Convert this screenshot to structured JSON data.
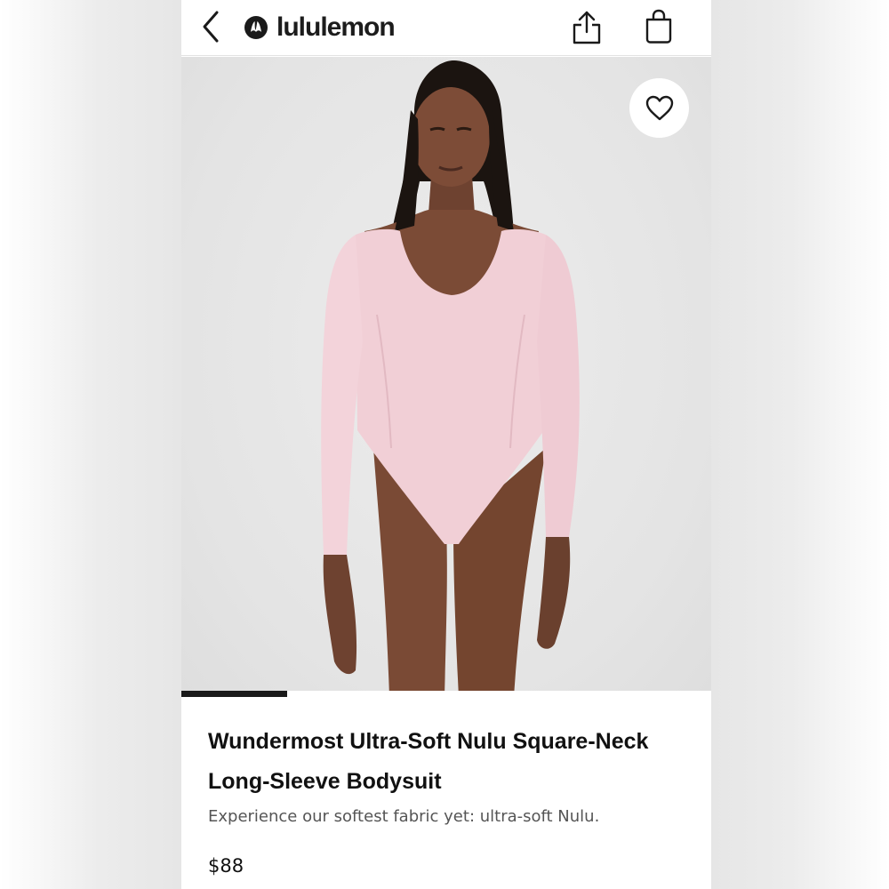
{
  "header": {
    "brand_name": "lululemon",
    "icons": {
      "back": "chevron-left-icon",
      "logo": "lululemon-logo-icon",
      "share": "share-icon",
      "bag": "shopping-bag-icon"
    }
  },
  "gallery": {
    "favorite_icon": "heart-icon",
    "image_position": {
      "current": 1,
      "progress_fraction": 0.2
    },
    "colors": {
      "background": "#e6e6e6",
      "garment": "#f1cfd6"
    }
  },
  "product": {
    "title": "Wundermost Ultra-Soft Nulu Square-Neck Long-Sleeve Bodysuit",
    "description": "Experience our softest fabric yet: ultra-soft Nulu.",
    "price": "$88"
  },
  "colors": {
    "text": "#111111",
    "muted": "#555555",
    "accent": "#1a1a1a"
  }
}
